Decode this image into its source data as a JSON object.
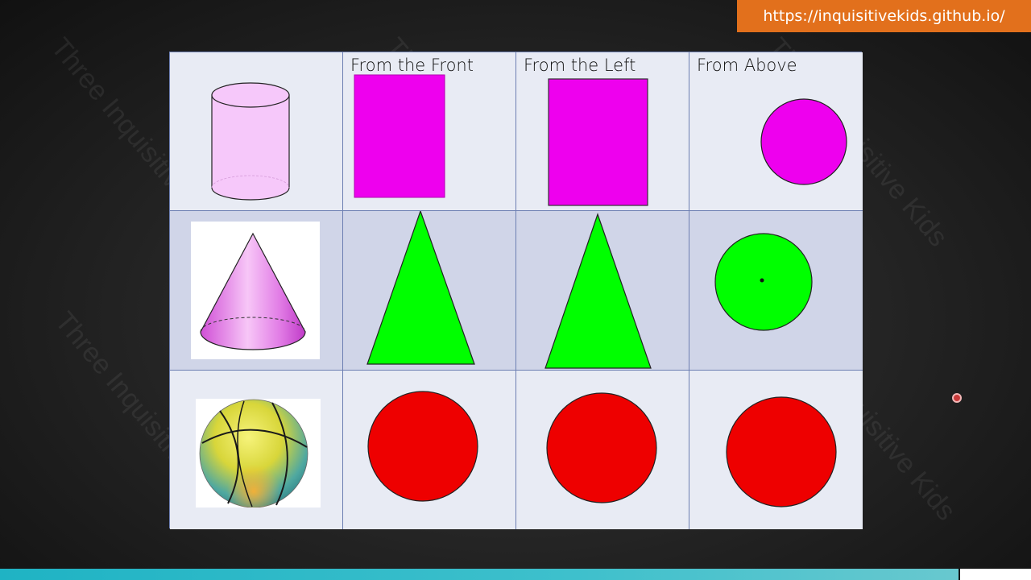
{
  "banner": {
    "url": "https://inquisitivekids.github.io/"
  },
  "watermark": {
    "text": "Three Inquisitive Kids"
  },
  "table": {
    "headers": [
      "",
      "From the Front",
      "From the Left",
      "From Above"
    ],
    "rows": [
      {
        "object": "cylinder",
        "front": "rectangle",
        "left": "rectangle",
        "above": "circle"
      },
      {
        "object": "cone",
        "front": "triangle",
        "left": "triangle",
        "above": "circle-with-center-dot"
      },
      {
        "object": "ball",
        "front": "circle",
        "left": "circle",
        "above": "circle"
      }
    ]
  },
  "colors": {
    "magenta": "#ee00ee",
    "cylinder_fill": "#f6c8fa",
    "green": "#00ff00",
    "red": "#ee0000",
    "grid_border": "#6d7fb2",
    "banner": "#e2701c",
    "footer": "#1fb3c4"
  },
  "icons": [
    "cylinder-icon",
    "cone-icon",
    "ball-icon",
    "cursor-indicator-icon"
  ]
}
